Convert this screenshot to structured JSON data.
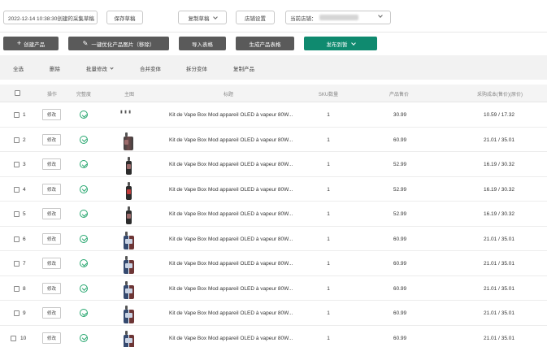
{
  "topbar": {
    "date_select": "2022-12-14 10:38:30创建的采集草稿",
    "save_draft": "保存草稿",
    "copy_draft": "复制草稿",
    "shop_settings": "店铺设置",
    "current_shop_label": "当前店铺："
  },
  "actions": {
    "create_product": "创建产品",
    "optimize_images": "一键优化产品图片（移除）",
    "import_table": "导入表格",
    "generate_table": "生成产品表格",
    "publish_to": "发布到暂"
  },
  "operations": {
    "select_all": "全选",
    "delete": "删除",
    "batch_edit": "批量修改",
    "merge_variants": "合并变体",
    "split_variants": "拆分变体",
    "copy_product": "复制产品"
  },
  "table": {
    "headers": {
      "operation": "操作",
      "completeness": "完整度",
      "main_image": "主图",
      "title": "标题",
      "sku_count": "SKU数量",
      "product_price": "产品售价",
      "purchase_cost": "采购成本(售价)(原价)"
    },
    "edit_label": "修改",
    "rows": [
      {
        "num": "1",
        "title": "Kit de Vape Box Mod appareil OLED à vapeur 80W...",
        "sku": "1",
        "price": "30.99",
        "cost": "10.59 / 17.32",
        "thumb": "trio"
      },
      {
        "num": "2",
        "title": "Kit de Vape Box Mod appareil OLED à vapeur 80W...",
        "sku": "1",
        "price": "60.99",
        "cost": "21.01 / 35.01",
        "thumb": "wide"
      },
      {
        "num": "3",
        "title": "Kit de Vape Box Mod appareil OLED à vapeur 80W...",
        "sku": "1",
        "price": "52.99",
        "cost": "16.19 / 30.32",
        "thumb": "dark"
      },
      {
        "num": "4",
        "title": "Kit de Vape Box Mod appareil OLED à vapeur 80W...",
        "sku": "1",
        "price": "52.99",
        "cost": "16.19 / 30.32",
        "thumb": "red"
      },
      {
        "num": "5",
        "title": "Kit de Vape Box Mod appareil OLED à vapeur 80W...",
        "sku": "1",
        "price": "52.99",
        "cost": "16.19 / 30.32",
        "thumb": "dark"
      },
      {
        "num": "6",
        "title": "Kit de Vape Box Mod appareil OLED à vapeur 80W...",
        "sku": "1",
        "price": "60.99",
        "cost": "21.01 / 35.01",
        "thumb": "pair"
      },
      {
        "num": "7",
        "title": "Kit de Vape Box Mod appareil OLED à vapeur 80W...",
        "sku": "1",
        "price": "60.99",
        "cost": "21.01 / 35.01",
        "thumb": "pair"
      },
      {
        "num": "8",
        "title": "Kit de Vape Box Mod appareil OLED à vapeur 80W...",
        "sku": "1",
        "price": "60.99",
        "cost": "21.01 / 35.01",
        "thumb": "pair"
      },
      {
        "num": "9",
        "title": "Kit de Vape Box Mod appareil OLED à vapeur 80W...",
        "sku": "1",
        "price": "60.99",
        "cost": "21.01 / 35.01",
        "thumb": "pair"
      },
      {
        "num": "10",
        "title": "Kit de Vape Box Mod appareil OLED à vapeur 80W...",
        "sku": "1",
        "price": "60.99",
        "cost": "21.01 / 35.01",
        "thumb": "pair"
      }
    ]
  },
  "colors": {
    "publish_green": "#0f8a6f",
    "action_gray": "#5a5a5a",
    "complete_check": "#26a66e"
  }
}
